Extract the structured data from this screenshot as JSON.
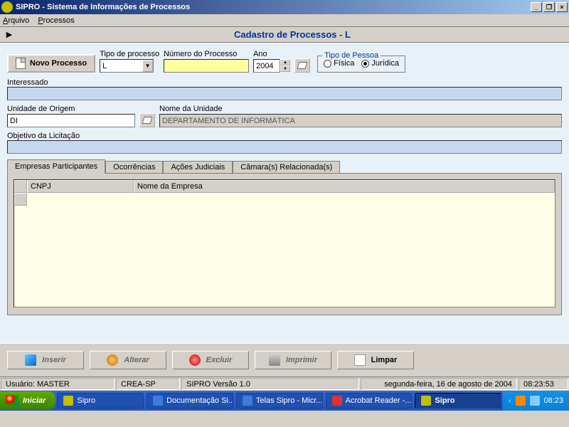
{
  "window": {
    "title": "SIPRO - Sistema de Informações de Processos"
  },
  "menu": {
    "arquivo": "Arquivo",
    "processos": "Processos"
  },
  "page_title": "Cadastro de Processos -  L",
  "novo_processo": "Novo Processo",
  "fields": {
    "tipo_processo": {
      "label": "Tipo de processo",
      "value": "L"
    },
    "numero_processo": {
      "label": "Número do Processo",
      "value": ""
    },
    "ano": {
      "label": "Ano",
      "value": "2004"
    },
    "tipo_pessoa": {
      "legend": "Tipo de Pessoa",
      "fisica": "Física",
      "juridica": "Jurídica",
      "selected": "juridica"
    },
    "interessado": {
      "label": "Interessado",
      "value": ""
    },
    "unidade_origem": {
      "label": "Unidade de Origem",
      "value": "DI"
    },
    "nome_unidade": {
      "label": "Nome da Unidade",
      "value": "DEPARTAMENTO DE INFORMÁTICA"
    },
    "objetivo": {
      "label": "Objetivo da Licitação",
      "value": ""
    }
  },
  "tabs": {
    "empresas": "Empresas Participantes",
    "ocorrencias": "Ocorrências",
    "acoes": "Ações Judiciais",
    "camaras": "Câmara(s) Relacionada(s)"
  },
  "grid": {
    "col_cnpj": "CNPJ",
    "col_nome": "Nome da Empresa"
  },
  "actions": {
    "inserir": "Inserir",
    "alterar": "Alterar",
    "excluir": "Excluir",
    "imprimir": "Imprimir",
    "limpar": "Limpar"
  },
  "status": {
    "usuario_label": "Usuário:",
    "usuario": "MASTER",
    "org": "CREA-SP",
    "versao": "SIPRO Versão 1.0",
    "data": "segunda-feira, 16 de agosto de 2004",
    "hora": "08:23:53"
  },
  "taskbar": {
    "start": "Iniciar",
    "items": [
      "Sipro",
      "Documentação Si...",
      "Telas Sipro - Micr...",
      "Acrobat Reader -...",
      "Sipro"
    ],
    "clock": "08:23"
  }
}
